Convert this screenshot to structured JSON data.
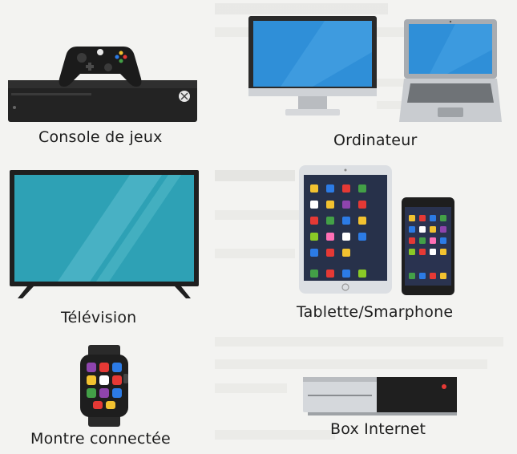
{
  "devices": [
    {
      "id": "console",
      "label": "Console de jeux"
    },
    {
      "id": "computer",
      "label": "Ordinateur"
    },
    {
      "id": "tv",
      "label": "Télévision"
    },
    {
      "id": "tablet",
      "label": "Tablette/Smarphone"
    },
    {
      "id": "watch",
      "label": "Montre connectée"
    },
    {
      "id": "box",
      "label": "Box Internet"
    }
  ],
  "colors": {
    "screen_blue": "#2f8fd8",
    "tv_screen": "#2ea1b5",
    "device_dark": "#2b2b2b",
    "device_silver": "#c9ccd0",
    "box_led": "#e53935"
  }
}
